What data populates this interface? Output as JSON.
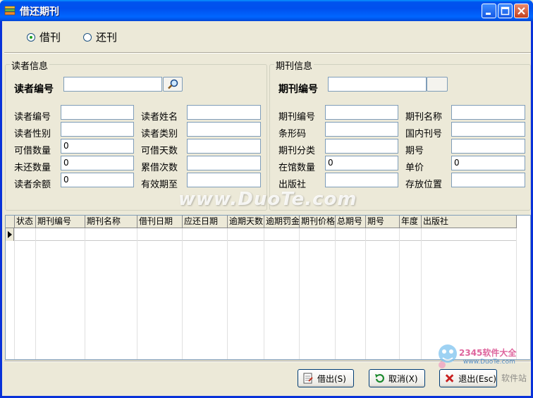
{
  "window": {
    "title": "借还期刊"
  },
  "mode": {
    "borrow_label": "借刊",
    "return_label": "还刊",
    "selected": "借刊"
  },
  "reader_group": {
    "legend": "读者信息",
    "search_label": "读者编号",
    "search_value": "",
    "fields": [
      {
        "label": "读者编号",
        "value": ""
      },
      {
        "label": "读者姓名",
        "value": ""
      },
      {
        "label": "读者性别",
        "value": ""
      },
      {
        "label": "读者类别",
        "value": ""
      },
      {
        "label": "可借数量",
        "value": "0"
      },
      {
        "label": "可借天数",
        "value": ""
      },
      {
        "label": "未还数量",
        "value": "0"
      },
      {
        "label": "累借次数",
        "value": ""
      },
      {
        "label": "读者余额",
        "value": "0"
      },
      {
        "label": "有效期至",
        "value": ""
      }
    ]
  },
  "periodical_group": {
    "legend": "期刊信息",
    "search_label": "期刊编号",
    "search_value": "",
    "fields": [
      {
        "label": "期刊编号",
        "value": ""
      },
      {
        "label": "期刊名称",
        "value": ""
      },
      {
        "label": "条形码",
        "value": ""
      },
      {
        "label": "国内刊号",
        "value": ""
      },
      {
        "label": "期刊分类",
        "value": ""
      },
      {
        "label": "期号",
        "value": ""
      },
      {
        "label": "在馆数量",
        "value": "0"
      },
      {
        "label": "单价",
        "value": "0"
      },
      {
        "label": "出版社",
        "value": ""
      },
      {
        "label": "存放位置",
        "value": ""
      }
    ]
  },
  "grid": {
    "columns": [
      "状态",
      "期刊编号",
      "期刊名称",
      "借刊日期",
      "应还日期",
      "逾期天数",
      "逾期罚金",
      "期刊价格",
      "总期号",
      "期号",
      "年度",
      "出版社"
    ],
    "rows": []
  },
  "buttons": {
    "lend": "借出(S)",
    "cancel": "取消(X)",
    "exit": "退出(Esc)"
  },
  "watermarks": {
    "center": "www.DuoTe.com",
    "logo_top": "2345软件大全",
    "logo_url": "www.DuoTe.com",
    "logo_bottom": "软件站"
  },
  "colors": {
    "titlebar": "#0054e3",
    "window_bg": "#ece9d8",
    "field_border": "#7f9db9"
  }
}
